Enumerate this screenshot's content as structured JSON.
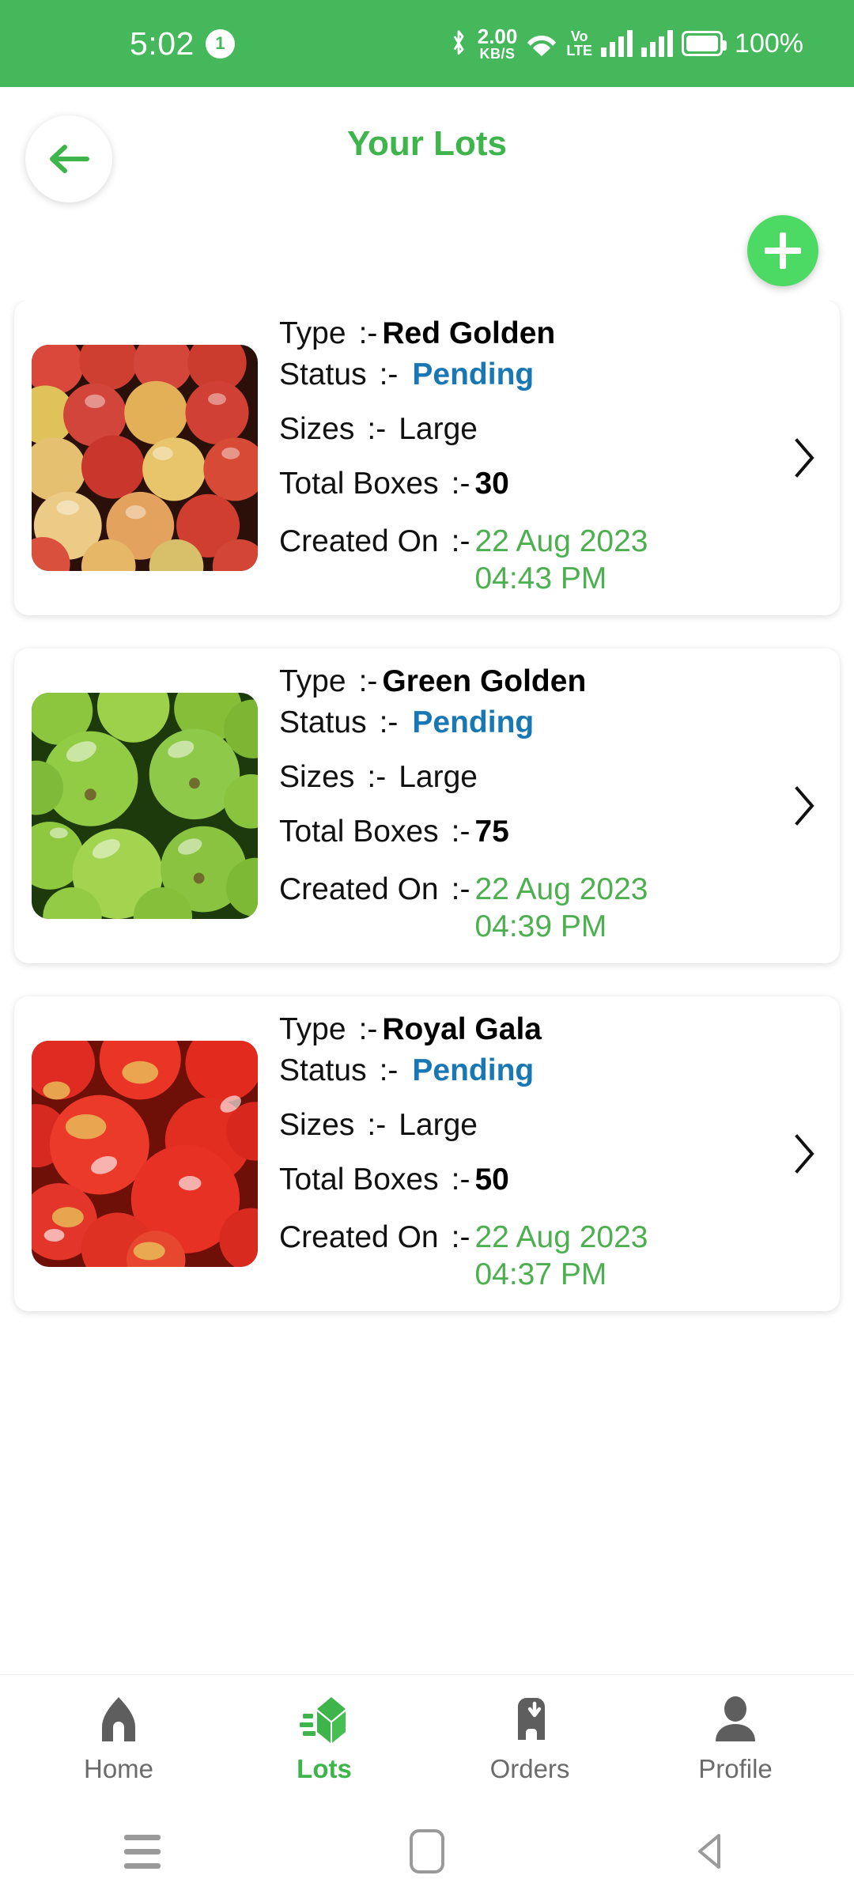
{
  "status_bar": {
    "time": "5:02",
    "notification_count": "1",
    "bluetooth_icon": "bluetooth-icon",
    "network_speed_value": "2.00",
    "network_speed_unit": "KB/S",
    "wifi_icon": "wifi-icon",
    "volte_line1": "Vo",
    "volte_line2": "LTE",
    "signal_icon": "signal-bars-icon",
    "battery_icon": "battery-icon",
    "battery_percent": "100%",
    "background_color": "#45B85C"
  },
  "header": {
    "back_icon": "arrow-left-icon",
    "title": "Your Lots",
    "title_color": "#3DB54A"
  },
  "add_button": {
    "icon": "plus-icon",
    "color": "#4CD964"
  },
  "labels": {
    "type": "Type",
    "status": "Status",
    "sizes": "Sizes",
    "total_boxes": "Total Boxes",
    "created_on": "Created On",
    "separator": ":-"
  },
  "colors": {
    "status_pending": "#1877B5",
    "date_green": "#4CAF50",
    "brand_green": "#3DB54A"
  },
  "lots": [
    {
      "image": "red-golden-apples-photo",
      "type": "Red Golden",
      "status": "Pending",
      "sizes": "Large",
      "total_boxes": "30",
      "created_on": "22 Aug 2023 04:43 PM",
      "chevron": "chevron-right-icon"
    },
    {
      "image": "green-golden-apples-photo",
      "type": "Green Golden",
      "status": "Pending",
      "sizes": "Large",
      "total_boxes": "75",
      "created_on": "22 Aug 2023 04:39 PM",
      "chevron": "chevron-right-icon"
    },
    {
      "image": "royal-gala-apples-photo",
      "type": "Royal Gala",
      "status": "Pending",
      "sizes": "Large",
      "total_boxes": "50",
      "created_on": "22 Aug 2023 04:37 PM",
      "chevron": "chevron-right-icon"
    }
  ],
  "bottom_nav": {
    "items": [
      {
        "label": "Home",
        "icon": "home-icon",
        "active": false
      },
      {
        "label": "Lots",
        "icon": "box-icon",
        "active": true
      },
      {
        "label": "Orders",
        "icon": "orders-icon",
        "active": false
      },
      {
        "label": "Profile",
        "icon": "person-icon",
        "active": false
      }
    ]
  },
  "system_nav": {
    "recents_icon": "recents-icon",
    "home_icon": "home-square-icon",
    "back_icon": "back-triangle-icon"
  }
}
